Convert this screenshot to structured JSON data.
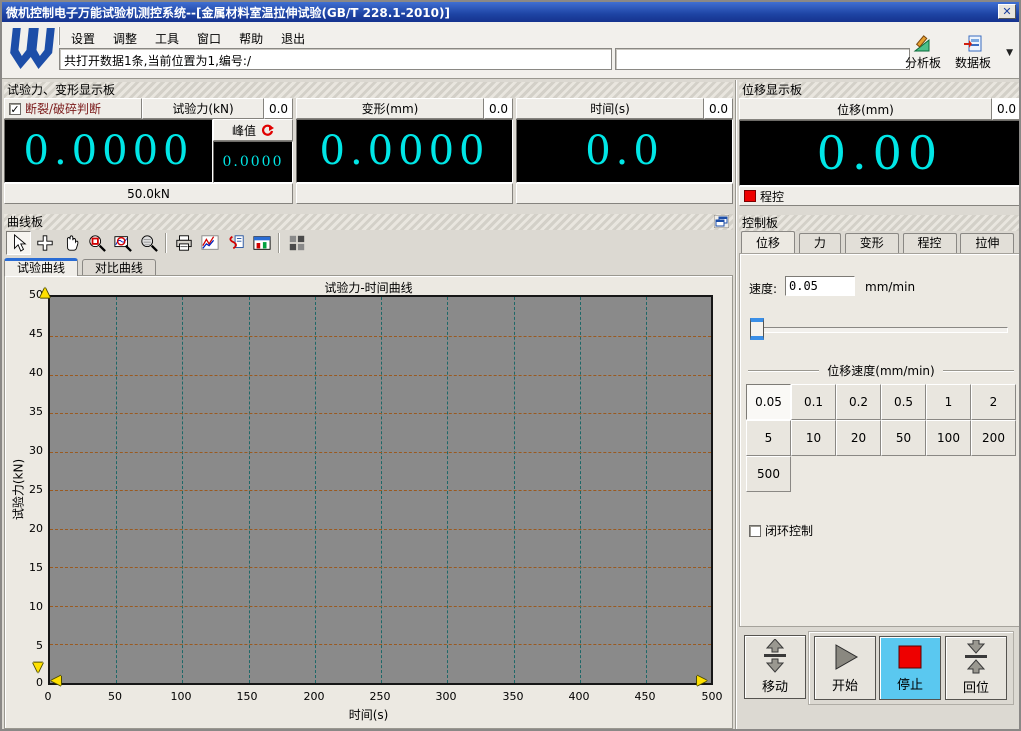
{
  "colors": {
    "title_bar": "#1e44a4",
    "display_digits": "#00e6e6",
    "alarm_text": "#7b1a1a",
    "stop_active_bg": "#5ac8f0",
    "peak_refresh_red": "#e00000",
    "plot_background": "#8a8a8a",
    "grid_horizontal": "#9a5a20",
    "grid_vertical": "#1e6868",
    "axis_marker_yellow": "#ffe000"
  },
  "window": {
    "title": "微机控制电子万能试验机测控系统--[金属材料室温拉伸试验(GB/T 228.1-2010)]",
    "close_glyph": "✕"
  },
  "menu": {
    "items": [
      "设置",
      "调整",
      "工具",
      "窗口",
      "帮助",
      "退出"
    ]
  },
  "toolbar": {
    "status_text": "共打开数据1条,当前位置为1,编号:/",
    "analysis_label": "分析板",
    "data_label": "数据板",
    "dropdown_glyph": "▼"
  },
  "force_panel": {
    "title": "试验力、变形显示板",
    "break_label": "断裂/破碎判断",
    "break_checked": "✓",
    "force": {
      "header": "试验力(kN)",
      "corner": "0.0",
      "value": "0.0000",
      "peak_label": "峰值",
      "peak_value": "0.0000",
      "range": "50.0kN"
    },
    "deform": {
      "header": "变形(mm)",
      "corner": "0.0",
      "value": "0.0000",
      "footer": ""
    },
    "time": {
      "header": "时间(s)",
      "corner": "0.0",
      "value": "0.0",
      "footer": ""
    }
  },
  "displacement_panel": {
    "title": "位移显示板",
    "header": "位移(mm)",
    "corner": "0.0",
    "value": "0.00",
    "mode_label": "程控"
  },
  "curve_panel": {
    "title": "曲线板",
    "tabs": [
      "试验曲线",
      "对比曲线"
    ],
    "active_tab": "试验曲线",
    "icons": [
      "cursor-icon",
      "crosshair-icon",
      "hand-icon",
      "zoom-rect-icon",
      "zoom-curve-icon",
      "zoom-out-icon",
      "print-icon",
      "curve-style-icon",
      "copy-curve-icon",
      "panel-config-icon",
      "grid-pattern-icon",
      "restore-window-icon"
    ]
  },
  "chart_data": {
    "type": "line",
    "title": "试验力-时间曲线",
    "xlabel": "时间(s)",
    "ylabel": "试验力(kN)",
    "xlim": [
      0,
      500
    ],
    "ylim": [
      0,
      50
    ],
    "x_ticks": [
      "0",
      "50",
      "100",
      "150",
      "200",
      "250",
      "300",
      "350",
      "400",
      "450",
      "500"
    ],
    "y_ticks": [
      "0",
      "5",
      "10",
      "15",
      "20",
      "25",
      "30",
      "35",
      "40",
      "45",
      "50"
    ],
    "grid": true,
    "legend": false,
    "series": [
      {
        "name": "试验力-时间",
        "x": [],
        "y": []
      }
    ]
  },
  "control_panel": {
    "title": "控制板",
    "tabs": [
      "位移",
      "力",
      "变形",
      "程控",
      "拉伸"
    ],
    "active_tab": "位移",
    "speed_label": "速度:",
    "speed_value": "0.05",
    "speed_unit": "mm/min",
    "group_title": "位移速度(mm/min)",
    "speed_options": [
      "0.05",
      "0.1",
      "0.2",
      "0.5",
      "1",
      "2",
      "5",
      "10",
      "20",
      "50",
      "100",
      "200",
      "500"
    ],
    "selected_speed": "0.05",
    "closed_loop_label": "闭环控制",
    "buttons": {
      "move": "移动",
      "start": "开始",
      "stop": "停止",
      "home": "回位"
    }
  }
}
